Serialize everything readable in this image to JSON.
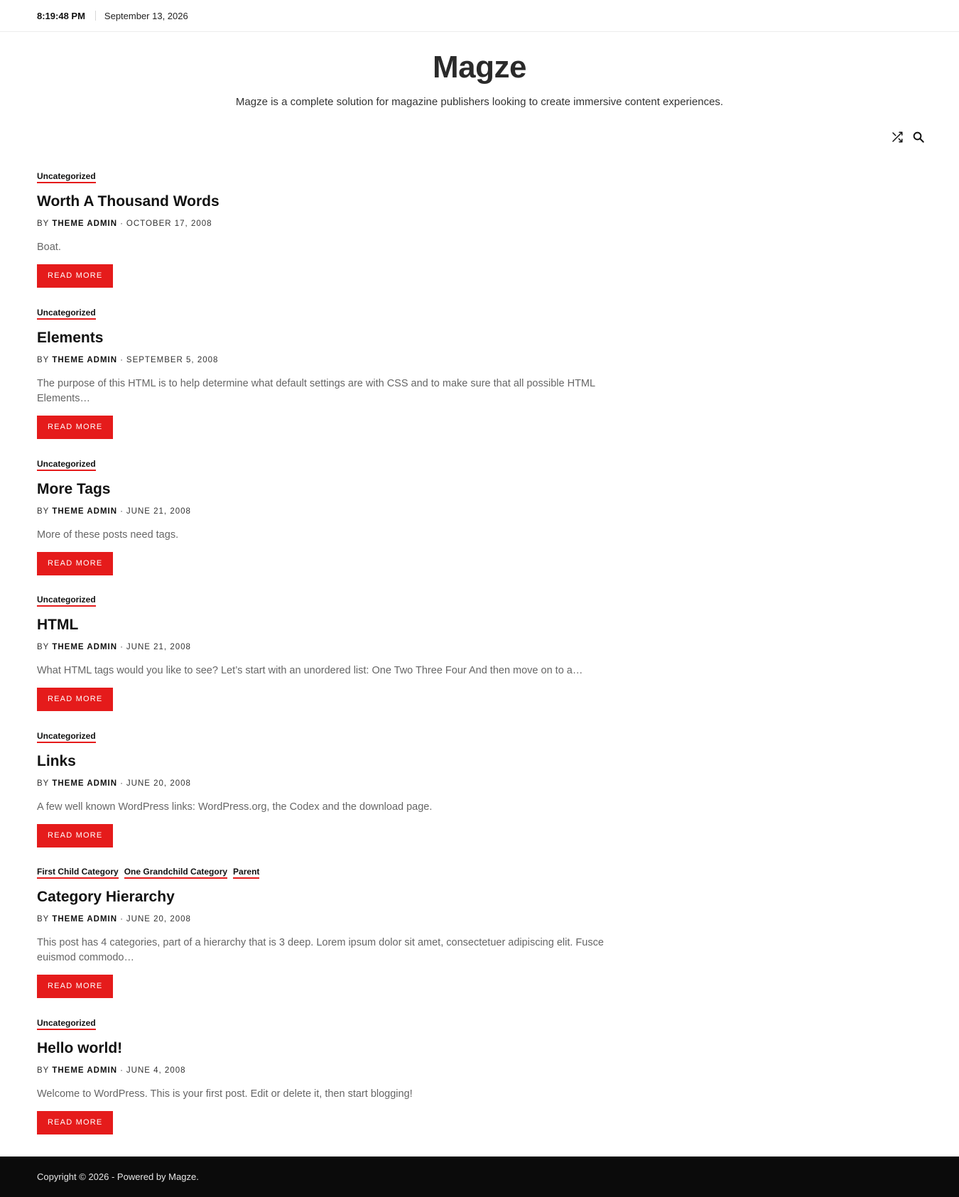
{
  "topbar": {
    "time": "8:19:48 PM",
    "date": "September 13, 2026"
  },
  "site": {
    "title": "Magze",
    "tagline": "Magze is a complete solution for magazine publishers looking to create immersive content experiences."
  },
  "icons": {
    "shuffle": "shuffle-icon",
    "search": "search-icon"
  },
  "colors": {
    "accent": "#e51b1b",
    "footer_bg": "#0b0b0b"
  },
  "posts": [
    {
      "categories": [
        "Uncategorized"
      ],
      "title": "Worth A Thousand Words",
      "by": "BY",
      "author": "THEME ADMIN",
      "date": "OCTOBER 17, 2008",
      "excerpt": "Boat.",
      "read_more": "READ MORE"
    },
    {
      "categories": [
        "Uncategorized"
      ],
      "title": "Elements",
      "by": "BY",
      "author": "THEME ADMIN",
      "date": "SEPTEMBER 5, 2008",
      "excerpt": "The purpose of this HTML is to help determine what default settings are with CSS and to make sure that all possible HTML Elements…",
      "read_more": "READ MORE"
    },
    {
      "categories": [
        "Uncategorized"
      ],
      "title": "More Tags",
      "by": "BY",
      "author": "THEME ADMIN",
      "date": "JUNE 21, 2008",
      "excerpt": "More of these posts need tags.",
      "read_more": "READ MORE"
    },
    {
      "categories": [
        "Uncategorized"
      ],
      "title": "HTML",
      "by": "BY",
      "author": "THEME ADMIN",
      "date": "JUNE 21, 2008",
      "excerpt": "What HTML tags would you like to see? Let’s start with an unordered list: One Two Three Four And then move on to a…",
      "read_more": "READ MORE"
    },
    {
      "categories": [
        "Uncategorized"
      ],
      "title": "Links",
      "by": "BY",
      "author": "THEME ADMIN",
      "date": "JUNE 20, 2008",
      "excerpt": "A few well known WordPress links: WordPress.org, the Codex and the download page.",
      "read_more": "READ MORE"
    },
    {
      "categories": [
        "First Child Category",
        "One Grandchild Category",
        "Parent"
      ],
      "title": "Category Hierarchy",
      "by": "BY",
      "author": "THEME ADMIN",
      "date": "JUNE 20, 2008",
      "excerpt": "This post has 4 categories, part of a hierarchy that is 3 deep. Lorem ipsum dolor sit amet, consectetuer adipiscing elit. Fusce euismod commodo…",
      "read_more": "READ MORE"
    },
    {
      "categories": [
        "Uncategorized"
      ],
      "title": "Hello world!",
      "by": "BY",
      "author": "THEME ADMIN",
      "date": "JUNE 4, 2008",
      "excerpt": "Welcome to WordPress. This is your first post. Edit or delete it, then start blogging!",
      "read_more": "READ MORE"
    }
  ],
  "footer": {
    "text": "Copyright © 2026  - Powered by Magze."
  }
}
